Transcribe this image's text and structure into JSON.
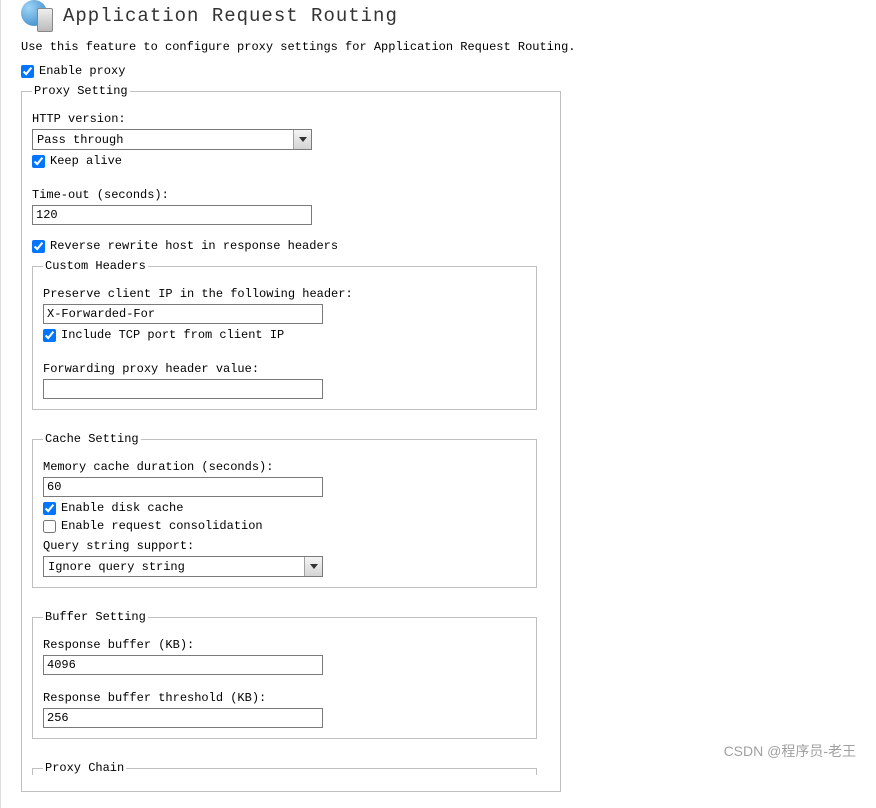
{
  "header": {
    "title": "Application Request Routing"
  },
  "description": "Use this feature to configure proxy settings for Application Request Routing.",
  "enableProxy": {
    "label": "Enable proxy",
    "checked": true
  },
  "proxySetting": {
    "legend": "Proxy Setting",
    "httpVersion": {
      "label": "HTTP version:",
      "value": "Pass through"
    },
    "keepAlive": {
      "label": "Keep alive",
      "checked": true
    },
    "timeout": {
      "label": "Time-out (seconds):",
      "value": "120"
    },
    "reverseRewrite": {
      "label": "Reverse rewrite host in response headers",
      "checked": true
    },
    "customHeaders": {
      "legend": "Custom Headers",
      "preserveClientIp": {
        "label": "Preserve client IP in the following header:",
        "value": "X-Forwarded-For"
      },
      "includeTcp": {
        "label": "Include TCP port from client IP",
        "checked": true
      },
      "forwardingProxy": {
        "label": "Forwarding proxy header value:",
        "value": ""
      }
    },
    "cacheSetting": {
      "legend": "Cache Setting",
      "memoryCache": {
        "label": "Memory cache duration (seconds):",
        "value": "60"
      },
      "enableDiskCache": {
        "label": "Enable disk cache",
        "checked": true
      },
      "enableRequestConsolidation": {
        "label": "Enable request consolidation",
        "checked": false
      },
      "queryStringSupport": {
        "label": "Query string support:",
        "value": "Ignore query string"
      }
    },
    "bufferSetting": {
      "legend": "Buffer Setting",
      "responseBuffer": {
        "label": "Response buffer (KB):",
        "value": "4096"
      },
      "responseBufferThreshold": {
        "label": "Response buffer threshold (KB):",
        "value": "256"
      }
    },
    "proxyChain": {
      "legend": "Proxy Chain"
    }
  },
  "watermark": "CSDN @程序员-老王"
}
